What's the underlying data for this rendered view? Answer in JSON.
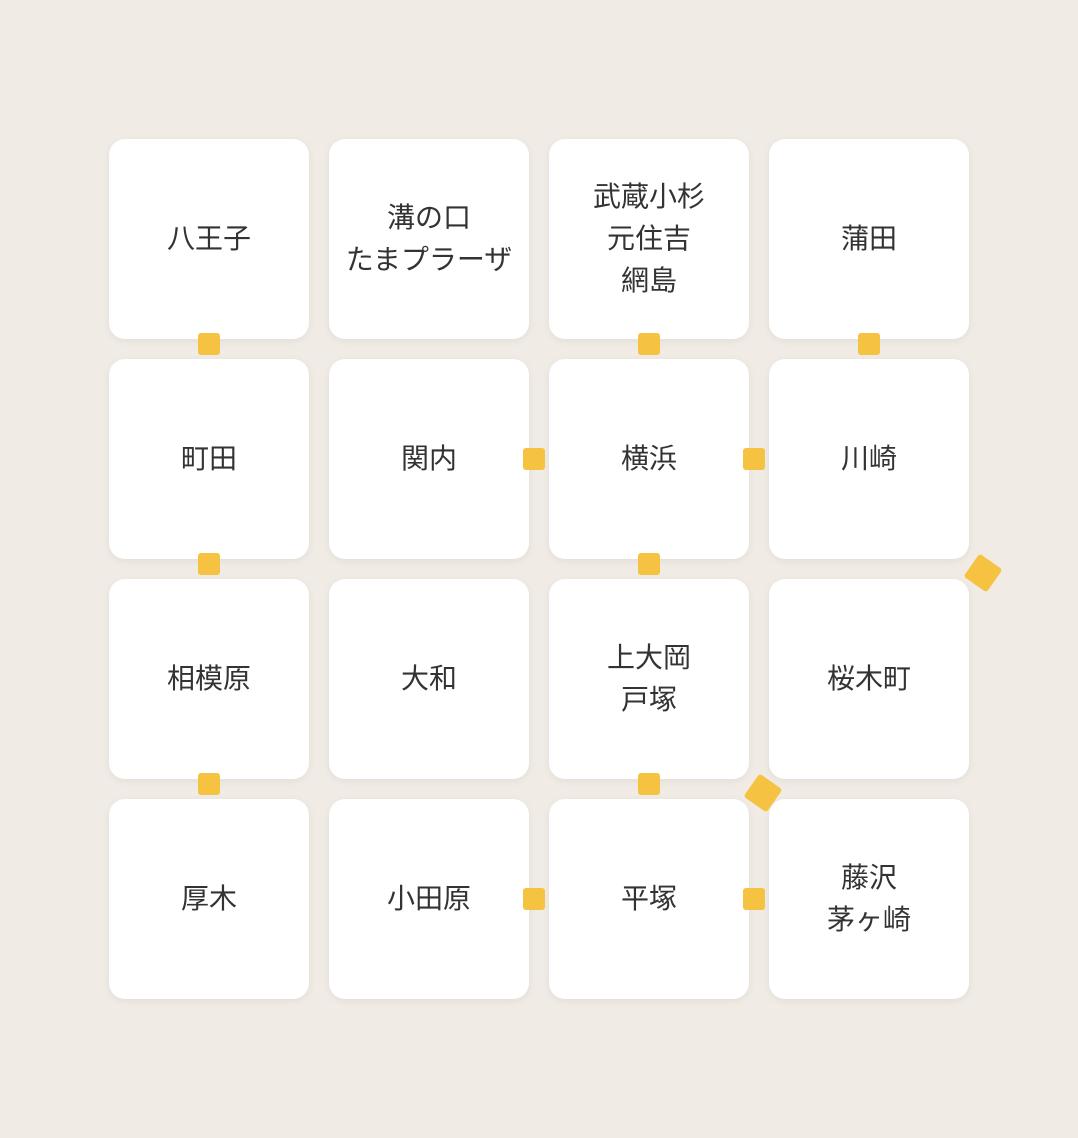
{
  "grid": {
    "cells": [
      {
        "id": "hachioji",
        "label": "八王子",
        "row": 1,
        "col": 1,
        "connectors": [
          "bottom"
        ]
      },
      {
        "id": "mizo-tama",
        "label": "溝の口\nたまプラーザ",
        "row": 1,
        "col": 2,
        "connectors": []
      },
      {
        "id": "musashi-etc",
        "label": "武蔵小杉\n元住吉\n網島",
        "row": 1,
        "col": 3,
        "connectors": [
          "bottom"
        ]
      },
      {
        "id": "kamata",
        "label": "蒲田",
        "row": 1,
        "col": 4,
        "connectors": [
          "bottom"
        ]
      },
      {
        "id": "machida",
        "label": "町田",
        "row": 2,
        "col": 1,
        "connectors": [
          "bottom"
        ]
      },
      {
        "id": "kannai",
        "label": "関内",
        "row": 2,
        "col": 2,
        "connectors": [
          "right"
        ]
      },
      {
        "id": "yokohama",
        "label": "横浜",
        "row": 2,
        "col": 3,
        "connectors": [
          "bottom",
          "right"
        ]
      },
      {
        "id": "kawasaki",
        "label": "川崎",
        "row": 2,
        "col": 4,
        "connectors": [
          "diag-br"
        ]
      },
      {
        "id": "sagamihara",
        "label": "相模原",
        "row": 3,
        "col": 1,
        "connectors": [
          "bottom"
        ]
      },
      {
        "id": "yamato",
        "label": "大和",
        "row": 3,
        "col": 2,
        "connectors": []
      },
      {
        "id": "kamiooka-totsuka",
        "label": "上大岡\n戸塚",
        "row": 3,
        "col": 3,
        "connectors": [
          "bottom",
          "diag-br"
        ]
      },
      {
        "id": "sakuragicho",
        "label": "桜木町",
        "row": 3,
        "col": 4,
        "connectors": []
      },
      {
        "id": "atsugi",
        "label": "厚木",
        "row": 4,
        "col": 1,
        "connectors": []
      },
      {
        "id": "odawara",
        "label": "小田原",
        "row": 4,
        "col": 2,
        "connectors": [
          "right"
        ]
      },
      {
        "id": "hiratsuka",
        "label": "平塚",
        "row": 4,
        "col": 3,
        "connectors": [
          "right"
        ]
      },
      {
        "id": "fujisawa-chigasaki",
        "label": "藤沢\n茅ヶ崎",
        "row": 4,
        "col": 4,
        "connectors": []
      }
    ]
  }
}
